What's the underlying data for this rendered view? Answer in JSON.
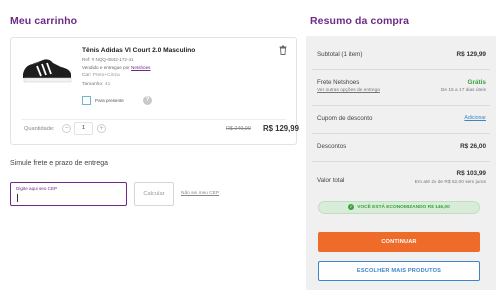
{
  "cart": {
    "title": "Meu carrinho",
    "product": {
      "name": "Tênis Adidas Vl Court 2.0 Masculino",
      "ref": "Ref: # NQQ-0842-172-41",
      "seller_prefix": "Vendido e entregue por",
      "seller": "Netshoes",
      "color_label": "Cor:",
      "color_value": "Preto+Cinza",
      "size_label": "Tamanho:",
      "size_value": "41",
      "gift_label": "Para presente",
      "quantity_label": "Quantidade:",
      "quantity": "1",
      "old_price": "R$ 249,99",
      "price": "R$ 129,99"
    }
  },
  "shipping": {
    "title": "Simule frete e prazo de entrega",
    "cep_placeholder": "Digite aqui seu CEP",
    "calculate_label": "Calcular",
    "no_cep_link": "Não sei meu CEP"
  },
  "summary": {
    "title": "Resumo da compra",
    "subtotal_label": "Subtotal (1 item)",
    "subtotal_value": "R$ 129,99",
    "shipping_label": "Frete Netshoes",
    "shipping_value": "Grátis",
    "shipping_other": "Ver outras opções de entrega",
    "shipping_days": "De 15 a 17 dias úteis",
    "coupon_label": "Cupom de desconto",
    "coupon_action": "Adicionar",
    "discounts_label": "Descontos",
    "discounts_value": "R$ 26,00",
    "total_label": "Valor total",
    "total_value": "R$ 103,99",
    "installments": "Em até 2x de R$ 52,00 sem juros",
    "savings": "VOCÊ ESTÁ ECONOMIZANDO R$ 146,00",
    "continue_label": "CONTINUAR",
    "more_label": "ESCOLHER MAIS PRODUTOS"
  },
  "colors": {
    "brand_purple": "#6d2a86",
    "continue_orange": "#ef6b29",
    "success_green": "#35a33b",
    "link_blue": "#3a86c8"
  }
}
